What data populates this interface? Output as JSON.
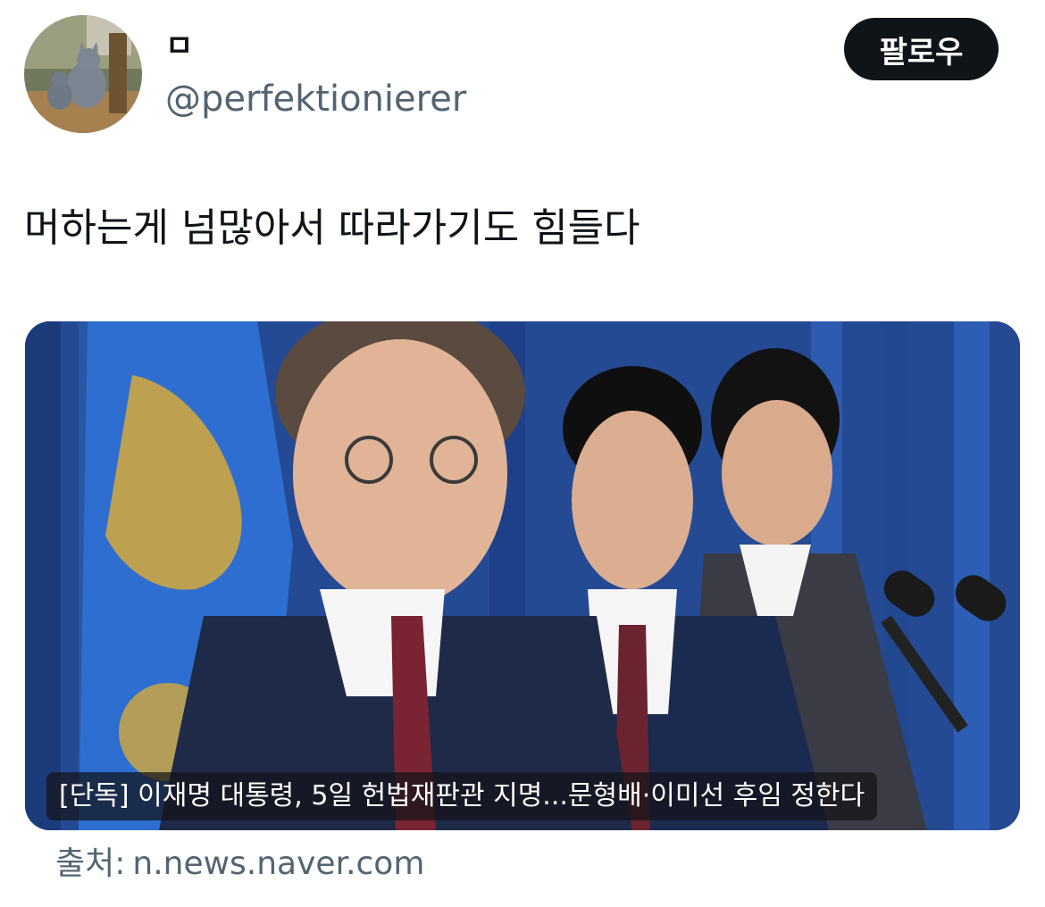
{
  "profile": {
    "display_name": "ㅁ",
    "handle": "@perfektionierer",
    "avatar_icon": "cat-photo-avatar"
  },
  "follow_button": {
    "label": "팔로우"
  },
  "tweet": {
    "text": "머하는게 넘많아서 따라가기도 힘들다"
  },
  "media_card": {
    "headline": "[단독] 이재명 대통령, 5일 헌법재판관 지명...문형배·이미선 후임 정한다",
    "source_label": "출처:",
    "source_domain": "n.news.naver.com"
  },
  "colors": {
    "text_primary": "#0f1419",
    "text_secondary": "#536471",
    "button_bg": "#0f1419",
    "button_text": "#ffffff"
  }
}
